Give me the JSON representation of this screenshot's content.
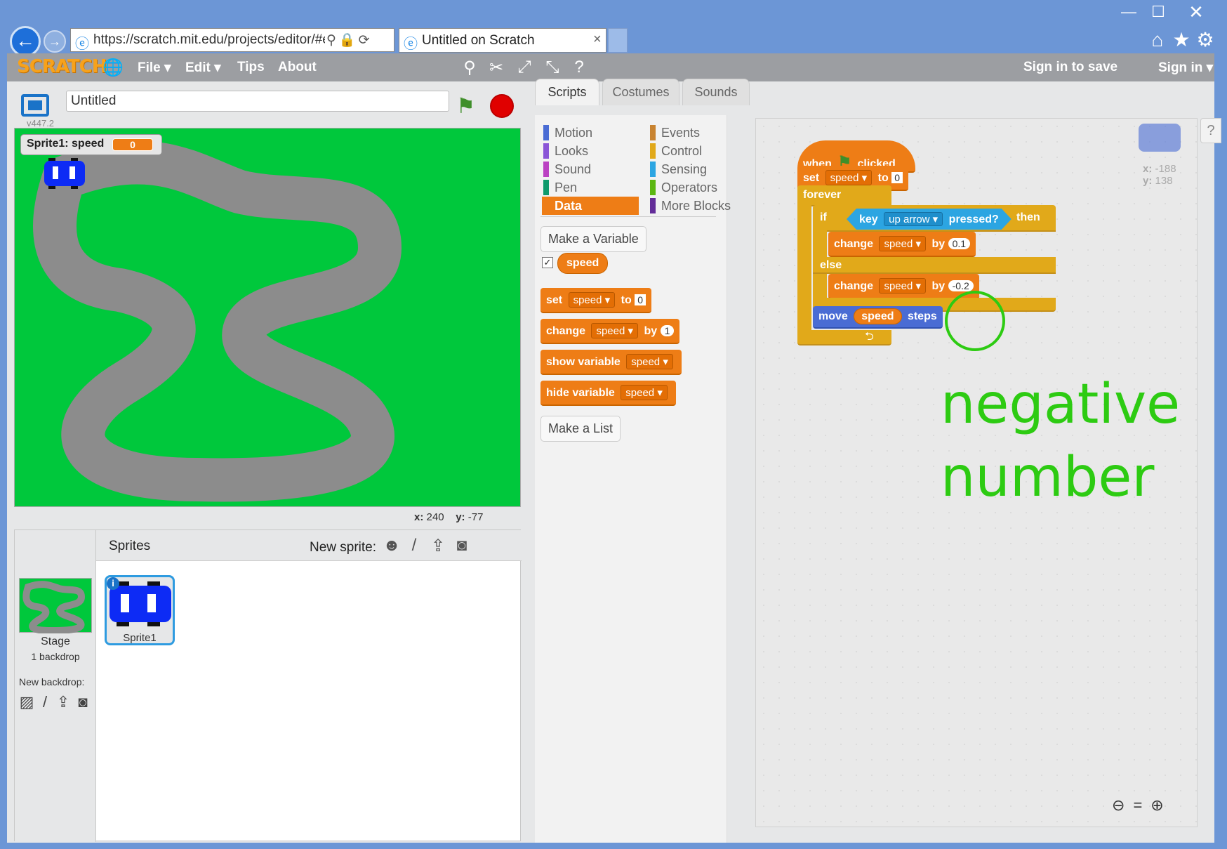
{
  "browser": {
    "url": "https://scratch.mit.edu/projects/editor/#e",
    "tab_title": "Untitled on Scratch",
    "window_buttons": [
      "minimize-icon",
      "maximize-icon",
      "close-icon"
    ]
  },
  "menubar": {
    "logo": "SCRATCH",
    "items": [
      "File ▾",
      "Edit ▾",
      "Tips",
      "About"
    ],
    "sign_in_save": "Sign in to save",
    "sign_in": "Sign in ▾"
  },
  "stage_panel": {
    "version": "v447.2",
    "project_title": "Untitled",
    "monitor_label": "Sprite1: speed",
    "monitor_value": "0",
    "coords_x_label": "x:",
    "coords_x": "240",
    "coords_y_label": "y:",
    "coords_y": "-77"
  },
  "sprites_panel": {
    "title": "Sprites",
    "new_sprite": "New sprite:",
    "stage_label": "Stage",
    "backdrops": "1 backdrop",
    "new_backdrop": "New backdrop:",
    "sprite_name": "Sprite1",
    "info": "i"
  },
  "tabs": [
    "Scripts",
    "Costumes",
    "Sounds"
  ],
  "categories_left": [
    {
      "label": "Motion",
      "color": "#4a6cd4"
    },
    {
      "label": "Looks",
      "color": "#8a55d7"
    },
    {
      "label": "Sound",
      "color": "#bb42c3"
    },
    {
      "label": "Pen",
      "color": "#0e9a6c"
    },
    {
      "label": "Data",
      "color": "#ee7d16"
    }
  ],
  "categories_right": [
    {
      "label": "Events",
      "color": "#c88330"
    },
    {
      "label": "Control",
      "color": "#e1a91a"
    },
    {
      "label": "Sensing",
      "color": "#2ca5e2"
    },
    {
      "label": "Operators",
      "color": "#5cb712"
    },
    {
      "label": "More Blocks",
      "color": "#632d99"
    }
  ],
  "palette": {
    "make_variable": "Make a Variable",
    "variable_name": "speed",
    "set_block": {
      "kw": "set",
      "var": "speed",
      "to": "to",
      "val": "0"
    },
    "change_block": {
      "kw": "change",
      "var": "speed",
      "by": "by",
      "val": "1"
    },
    "show_block": {
      "kw": "show variable",
      "var": "speed"
    },
    "hide_block": {
      "kw": "hide variable",
      "var": "speed"
    },
    "make_list": "Make a List"
  },
  "script": {
    "hat_when": "when",
    "hat_clicked": "clicked",
    "set_kw": "set",
    "set_var": "speed",
    "set_to": "to",
    "set_val": "0",
    "forever": "forever",
    "if": "if",
    "key": "key",
    "key_dd": "up arrow",
    "pressed": "pressed?",
    "then": "then",
    "change1_kw": "change",
    "change1_var": "speed",
    "change1_by": "by",
    "change1_val": "0.1",
    "else": "else",
    "change2_kw": "change",
    "change2_var": "speed",
    "change2_by": "by",
    "change2_val": "-0.2",
    "move": "move",
    "move_var": "speed",
    "steps": "steps",
    "loop_arrow": "⮌"
  },
  "sprite_info": {
    "x_label": "x:",
    "x": "-188",
    "y_label": "y:",
    "y": "138"
  },
  "annotation": {
    "line1": "negative",
    "line2": "number"
  },
  "colors": {
    "data": "#ee7d16",
    "control": "#e1a91a",
    "motion": "#4a6cd4",
    "sensing": "#2ca5e2",
    "annotation": "#2dcb12",
    "stage": "#00c83c"
  }
}
